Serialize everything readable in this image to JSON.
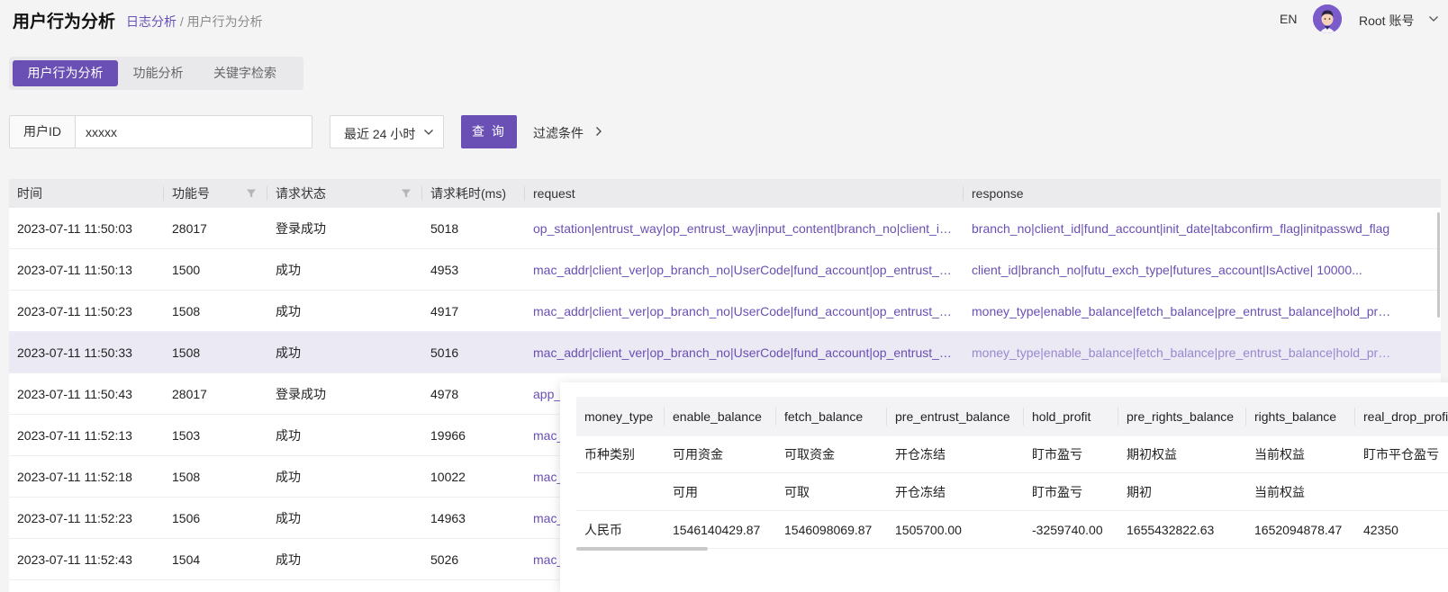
{
  "header": {
    "title": "用户行为分析",
    "breadcrumb_link": "日志分析",
    "breadcrumb_sep": " / ",
    "breadcrumb_current": "用户行为分析",
    "lang": "EN",
    "account": "Root 账号"
  },
  "tabs": [
    {
      "label": "用户行为分析",
      "active": true
    },
    {
      "label": "功能分析",
      "active": false
    },
    {
      "label": "关键字检索",
      "active": false
    }
  ],
  "filters": {
    "user_id_label": "用户ID",
    "user_id_value": "xxxxx",
    "range_value": "最近 24 小时",
    "query_label": "查 询",
    "filter_link": "过滤条件"
  },
  "table": {
    "columns": [
      "时间",
      "功能号",
      "请求状态",
      "请求耗时(ms)",
      "request",
      "response"
    ],
    "rows": [
      {
        "time": "2023-07-11 11:50:03",
        "func": "28017",
        "status": "登录成功",
        "cost": "5018",
        "request": "op_station|entrust_way|op_entrust_way|input_content|branch_no|client_id|password",
        "response": "branch_no|client_id|fund_account|init_date|tabconfirm_flag|initpasswd_flag"
      },
      {
        "time": "2023-07-11 11:50:13",
        "func": "1500",
        "status": "成功",
        "cost": "4953",
        "request": "mac_addr|client_ver|op_branch_no|UserCode|fund_account|op_entrust_way",
        "response": "client_id|branch_no|futu_exch_type|futures_account|IsActive| 10000..."
      },
      {
        "time": "2023-07-11 11:50:23",
        "func": "1508",
        "status": "成功",
        "cost": "4917",
        "request": "mac_addr|client_ver|op_branch_no|UserCode|fund_account|op_entrust_way",
        "response": "money_type|enable_balance|fetch_balance|pre_entrust_balance|hold_profit"
      },
      {
        "time": "2023-07-11 11:50:33",
        "func": "1508",
        "status": "成功",
        "cost": "5016",
        "request": "mac_addr|client_ver|op_branch_no|UserCode|fund_account|op_entrust_way",
        "response": "money_type|enable_balance|fetch_balance|pre_entrust_balance|hold_profit"
      },
      {
        "time": "2023-07-11 11:50:43",
        "func": "28017",
        "status": "登录成功",
        "cost": "4978",
        "request": "app_",
        "response": ""
      },
      {
        "time": "2023-07-11 11:52:13",
        "func": "1503",
        "status": "成功",
        "cost": "19966",
        "request": "mac_",
        "response": ""
      },
      {
        "time": "2023-07-11 11:52:18",
        "func": "1508",
        "status": "成功",
        "cost": "10022",
        "request": "mac_",
        "response": ""
      },
      {
        "time": "2023-07-11 11:52:23",
        "func": "1506",
        "status": "成功",
        "cost": "14963",
        "request": "mac_",
        "response": ""
      },
      {
        "time": "2023-07-11 11:52:43",
        "func": "1504",
        "status": "成功",
        "cost": "5026",
        "request": "mac_",
        "response": ""
      }
    ]
  },
  "popover": {
    "columns": [
      "money_type",
      "enable_balance",
      "fetch_balance",
      "pre_entrust_balance",
      "hold_profit",
      "pre_rights_balance",
      "rights_balance",
      "real_drop_profit"
    ],
    "rows": [
      [
        "币种类别",
        "可用资金",
        "可取资金",
        "开仓冻结",
        "盯市盈亏",
        "期初权益",
        "当前权益",
        "盯市平仓盈亏"
      ],
      [
        "",
        "可用",
        "可取",
        "开仓冻结",
        "盯市盈亏",
        "期初",
        "当前权益",
        ""
      ],
      [
        "人民币",
        "1546140429.87",
        "1546098069.87",
        "1505700.00",
        "-3259740.00",
        "1655432822.63",
        "1652094878.47",
        "42350"
      ]
    ]
  },
  "colors": {
    "accent": "#6a4fb5",
    "background": "#f4f4f5"
  }
}
